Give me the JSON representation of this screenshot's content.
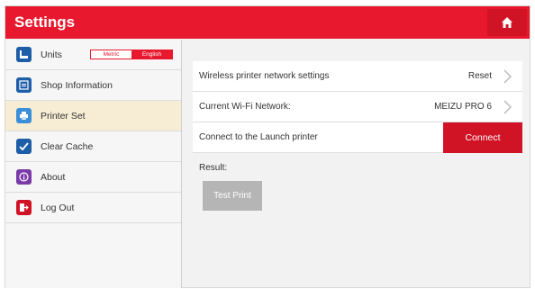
{
  "header": {
    "title": "Settings",
    "home_icon": "home-icon",
    "accent_color": "#e8192e"
  },
  "sidebar": {
    "items": [
      {
        "label": "Units",
        "icon": "units-icon",
        "icon_color": "#1e5ea8"
      },
      {
        "label": "Shop Information",
        "icon": "shop-info-icon",
        "icon_color": "#1e5ea8"
      },
      {
        "label": "Printer Set",
        "icon": "printer-icon",
        "icon_color": "#3b8fd9"
      },
      {
        "label": "Clear Cache",
        "icon": "clear-cache-icon",
        "icon_color": "#1e5ea8"
      },
      {
        "label": "About",
        "icon": "about-icon",
        "icon_color": "#7a3aa8"
      },
      {
        "label": "Log Out",
        "icon": "logout-icon",
        "icon_color": "#d01425"
      }
    ],
    "units_toggle": {
      "metric": "Metric",
      "english": "English",
      "selected": "English"
    }
  },
  "main": {
    "rows": [
      {
        "label": "Wireless printer network settings",
        "value": "Reset"
      },
      {
        "label": "Current Wi-Fi Network:",
        "value": "MEIZU PRO 6"
      },
      {
        "label": "Connect to the Launch printer",
        "button": "Connect"
      }
    ],
    "result_label": "Result:",
    "test_print": "Test Print"
  }
}
